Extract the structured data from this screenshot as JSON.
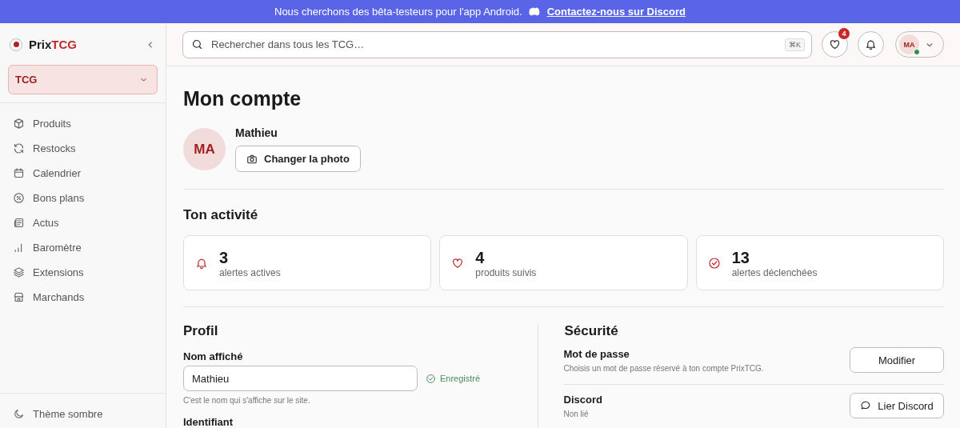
{
  "banner": {
    "text": "Nous cherchons des bêta-testeurs pour l'app Android.",
    "link": "Contactez-nous sur Discord"
  },
  "sidebar": {
    "brand": {
      "prefix": "Prix",
      "accent": "TCG"
    },
    "selector": {
      "value": "TCG"
    },
    "items": [
      {
        "label": "Produits",
        "kind": "box"
      },
      {
        "label": "Restocks",
        "kind": "refresh"
      },
      {
        "label": "Calendrier",
        "kind": "calendar"
      },
      {
        "label": "Bons plans",
        "kind": "percent"
      },
      {
        "label": "Actus",
        "kind": "news"
      },
      {
        "label": "Baromètre",
        "kind": "bars"
      },
      {
        "label": "Extensions",
        "kind": "layers"
      },
      {
        "label": "Marchands",
        "kind": "store"
      }
    ],
    "footer": {
      "label": "Thème sombre"
    }
  },
  "header": {
    "search": {
      "placeholder": "Rechercher dans tous les TCG…",
      "shortcut": "⌘K"
    },
    "favorites_badge": "4",
    "avatar": {
      "initials": "MA",
      "online": true
    }
  },
  "page": {
    "title": "Mon compte",
    "profile": {
      "initials": "MA",
      "name": "Mathieu",
      "photo_button": "Changer la photo"
    },
    "activity": {
      "title": "Ton activité",
      "stats": [
        {
          "kind": "bell",
          "value": "3",
          "label": "alertes actives"
        },
        {
          "kind": "heart",
          "value": "4",
          "label": "produits suivis"
        },
        {
          "kind": "check",
          "value": "13",
          "label": "alertes déclenchées"
        }
      ]
    },
    "profile_form": {
      "title": "Profil",
      "fields": [
        {
          "label": "Nom affiché",
          "value": "Mathieu",
          "status": "Enregistré",
          "hint": "C'est le nom qui s'affiche sur le site."
        },
        {
          "label": "Identifiant"
        }
      ]
    },
    "security": {
      "title": "Sécurité",
      "rows": [
        {
          "title": "Mot de passe",
          "description": "Choisis un mot de passe réservé à ton compte PrixTCG.",
          "button": "Modifier",
          "kind": "plain"
        },
        {
          "title": "Discord",
          "description": "Non lié",
          "button": "Lier Discord",
          "kind": "chat"
        }
      ]
    }
  }
}
